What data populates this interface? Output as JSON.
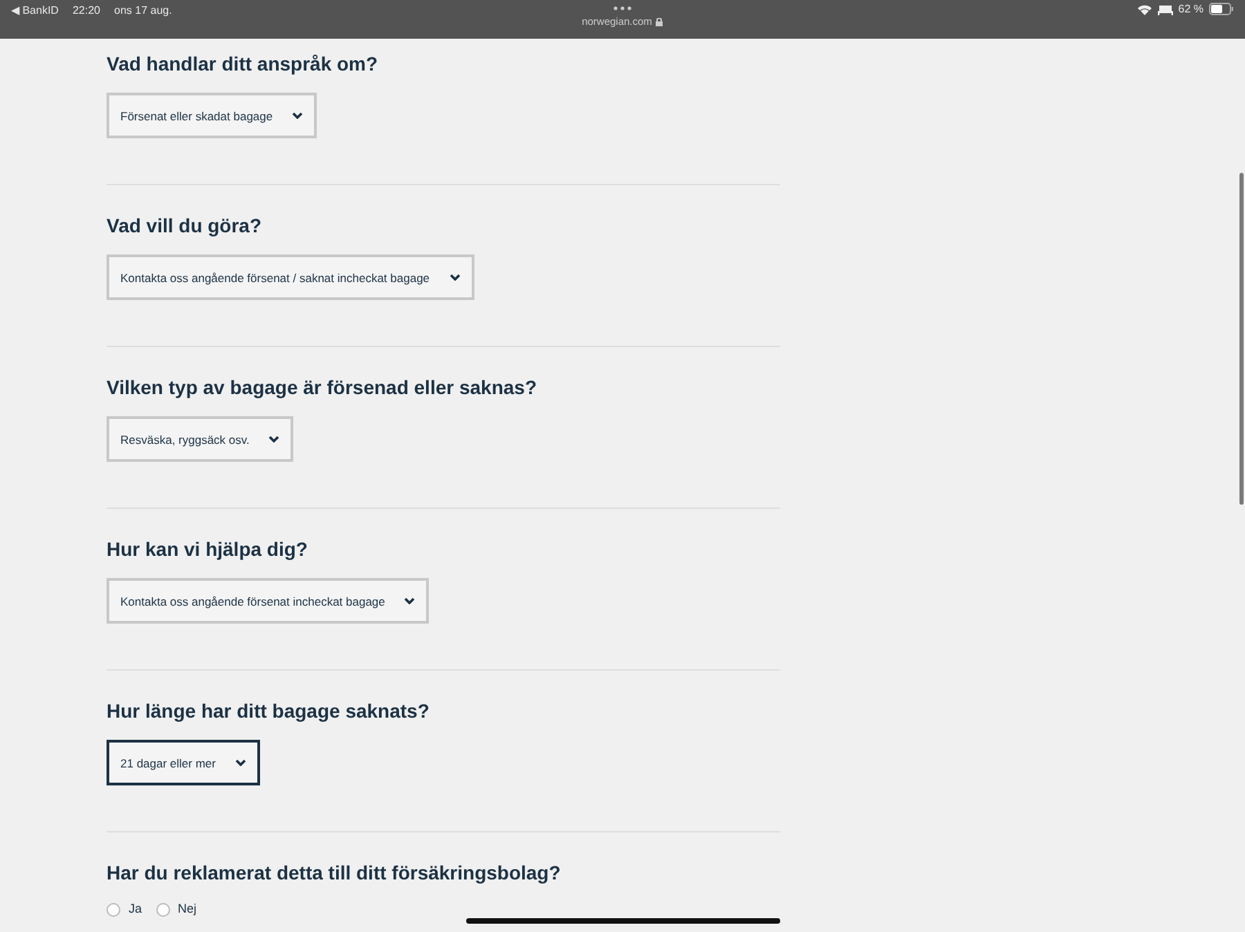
{
  "status_bar": {
    "back": "◀ BankID",
    "time": "22:20",
    "date": "ons 17 aug.",
    "url": "norwegian.com",
    "battery": "62 %"
  },
  "questions": [
    {
      "kind": "select",
      "label": "Vad handlar ditt anspråk om?",
      "value": "Försenat eller skadat bagage",
      "focused": false
    },
    {
      "kind": "select",
      "label": "Vad vill du göra?",
      "value": "Kontakta oss angående försenat / saknat incheckat bagage",
      "focused": false
    },
    {
      "kind": "select",
      "label": "Vilken typ av bagage är försenad eller saknas?",
      "value": "Resväska, ryggsäck osv.",
      "focused": false
    },
    {
      "kind": "select",
      "label": "Hur kan vi hjälpa dig?",
      "value": "Kontakta oss angående försenat incheckat bagage",
      "focused": false
    },
    {
      "kind": "select",
      "label": "Hur länge har ditt bagage saknats?",
      "value": "21 dagar eller mer",
      "focused": true
    },
    {
      "kind": "radio",
      "label": "Har du reklamerat detta till ditt försäkringsbolag?",
      "options": [
        {
          "label": "Ja",
          "selected": false
        },
        {
          "label": "Nej",
          "selected": false
        }
      ]
    }
  ]
}
